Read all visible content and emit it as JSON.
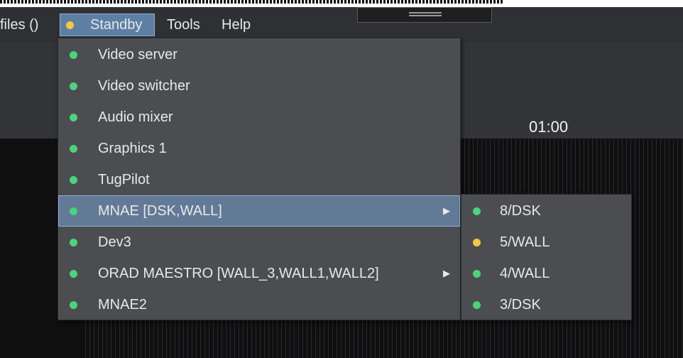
{
  "menubar": {
    "profiles_label": "files ()",
    "standby_label": "Standby",
    "standby_status_color": "#f5c842",
    "tools_label": "Tools",
    "help_label": "Help"
  },
  "clock": {
    "time": "01:00"
  },
  "dropdown": {
    "items": [
      {
        "label": "Video server",
        "status": "green",
        "submenu": false
      },
      {
        "label": "Video switcher",
        "status": "green",
        "submenu": false
      },
      {
        "label": "Audio mixer",
        "status": "green",
        "submenu": false
      },
      {
        "label": "Graphics 1",
        "status": "green",
        "submenu": false
      },
      {
        "label": "TugPilot",
        "status": "green",
        "submenu": false
      },
      {
        "label": "MNAE [DSK,WALL]",
        "status": "green",
        "submenu": true,
        "highlighted": true
      },
      {
        "label": "Dev3",
        "status": "green",
        "submenu": false
      },
      {
        "label": "ORAD MAESTRO [WALL_3,WALL1,WALL2]",
        "status": "green",
        "submenu": true
      },
      {
        "label": "MNAE2",
        "status": "green",
        "submenu": false
      }
    ],
    "submenu_arrow": "▶"
  },
  "submenu": {
    "items": [
      {
        "label": "8/DSK",
        "status": "green"
      },
      {
        "label": "5/WALL",
        "status": "yellow"
      },
      {
        "label": "4/WALL",
        "status": "green"
      },
      {
        "label": "3/DSK",
        "status": "green"
      }
    ]
  },
  "colors": {
    "status_green": "#4cd47b",
    "status_yellow": "#f5c842",
    "highlight": "#637a96"
  }
}
